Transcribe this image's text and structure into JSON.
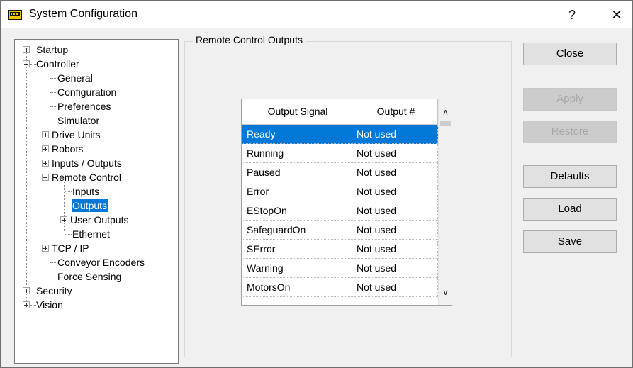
{
  "window": {
    "title": "System Configuration",
    "help": "?",
    "close": "✕"
  },
  "tree": {
    "items": [
      {
        "label": "Startup"
      },
      {
        "label": "Controller"
      },
      {
        "label": "General"
      },
      {
        "label": "Configuration"
      },
      {
        "label": "Preferences"
      },
      {
        "label": "Simulator"
      },
      {
        "label": "Drive Units"
      },
      {
        "label": "Robots"
      },
      {
        "label": "Inputs / Outputs"
      },
      {
        "label": "Remote Control"
      },
      {
        "label": "Inputs"
      },
      {
        "label": "Outputs"
      },
      {
        "label": "User Outputs"
      },
      {
        "label": "Ethernet"
      },
      {
        "label": "TCP / IP"
      },
      {
        "label": "Conveyor Encoders"
      },
      {
        "label": "Force Sensing"
      },
      {
        "label": "Security"
      },
      {
        "label": "Vision"
      }
    ]
  },
  "panel": {
    "title": "Remote Control Outputs",
    "columns": [
      "Output Signal",
      "Output #"
    ],
    "rows": [
      {
        "signal": "Ready",
        "output": "Not used"
      },
      {
        "signal": "Running",
        "output": "Not used"
      },
      {
        "signal": "Paused",
        "output": "Not used"
      },
      {
        "signal": "Error",
        "output": "Not used"
      },
      {
        "signal": "EStopOn",
        "output": "Not used"
      },
      {
        "signal": "SafeguardOn",
        "output": "Not used"
      },
      {
        "signal": "SError",
        "output": "Not used"
      },
      {
        "signal": "Warning",
        "output": "Not used"
      },
      {
        "signal": "MotorsOn",
        "output": "Not used"
      }
    ]
  },
  "buttons": {
    "close": "Close",
    "apply": "Apply",
    "restore": "Restore",
    "defaults": "Defaults",
    "load": "Load",
    "save": "Save"
  }
}
